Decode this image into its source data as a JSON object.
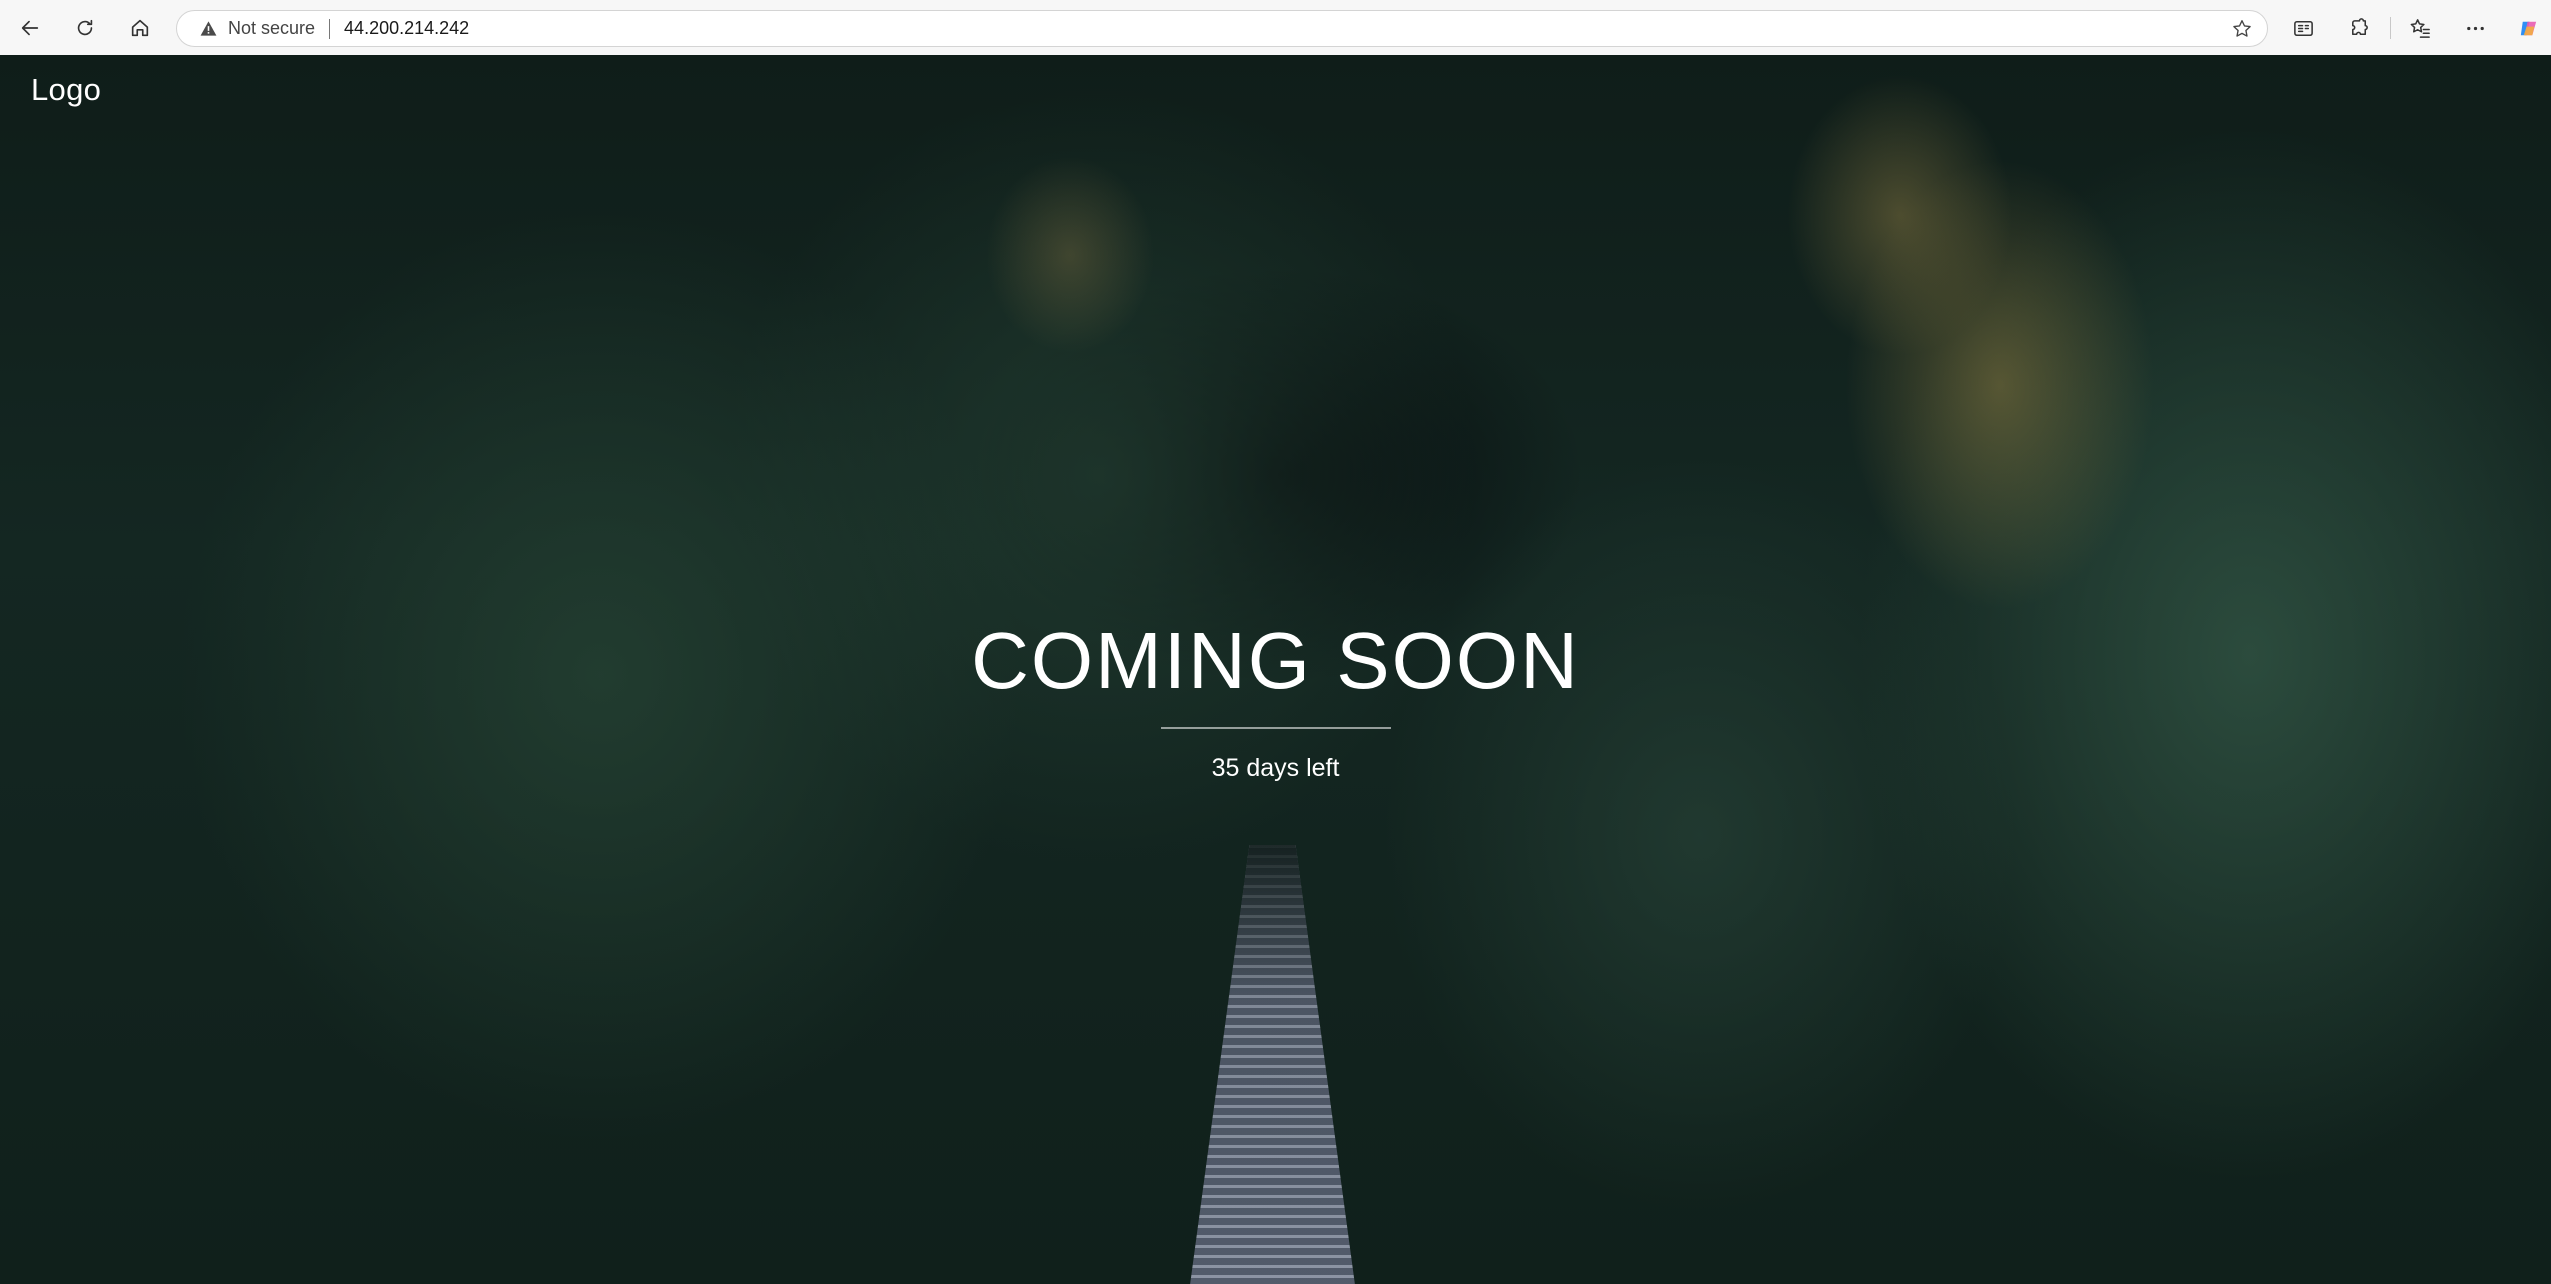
{
  "browser": {
    "security_label": "Not secure",
    "url": "44.200.214.242",
    "icons": {
      "back": "back-arrow-icon",
      "reload": "reload-icon",
      "home": "home-icon",
      "warning": "warning-triangle-icon",
      "favorite": "star-icon",
      "reader": "immersive-reader-icon",
      "extensions": "puzzle-piece-icon",
      "favorites": "favorites-icon",
      "more": "ellipsis-icon",
      "copilot": "copilot-icon"
    }
  },
  "page": {
    "logo": "Logo",
    "title": "COMING SOON",
    "countdown": "35 days left",
    "text_color": "#ffffff",
    "background_theme": "dark forest with suspension bridge"
  }
}
